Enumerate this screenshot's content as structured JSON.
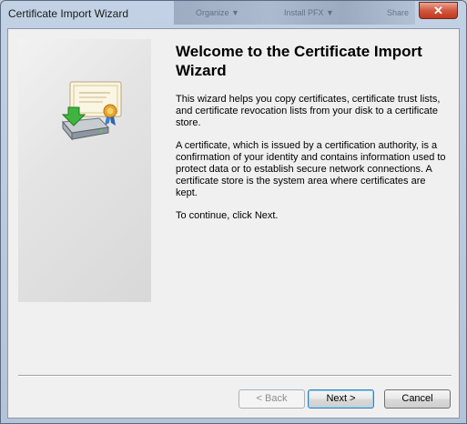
{
  "window": {
    "title": "Certificate Import Wizard"
  },
  "titlebar_background": {
    "ghost1": "Organize ▼",
    "ghost2": "Install PFX ▼",
    "ghost3": "Share"
  },
  "wizard": {
    "heading": "Welcome to the Certificate Import Wizard",
    "paragraph1": "This wizard helps you copy certificates, certificate trust lists, and certificate revocation lists from your disk to a certificate store.",
    "paragraph2": "A certificate, which is issued by a certification authority, is a confirmation of your identity and contains information used to protect data or to establish secure network connections. A certificate store is the system area where certificates are kept.",
    "paragraph3": "To continue, click Next."
  },
  "buttons": {
    "back": "< Back",
    "next": "Next >",
    "cancel": "Cancel",
    "close": "✕"
  },
  "icons": {
    "illustration": "certificate-import-icon",
    "close": "close-icon"
  },
  "colors": {
    "accent_close": "#c2371f",
    "default_button_border": "#3c7fb1"
  }
}
